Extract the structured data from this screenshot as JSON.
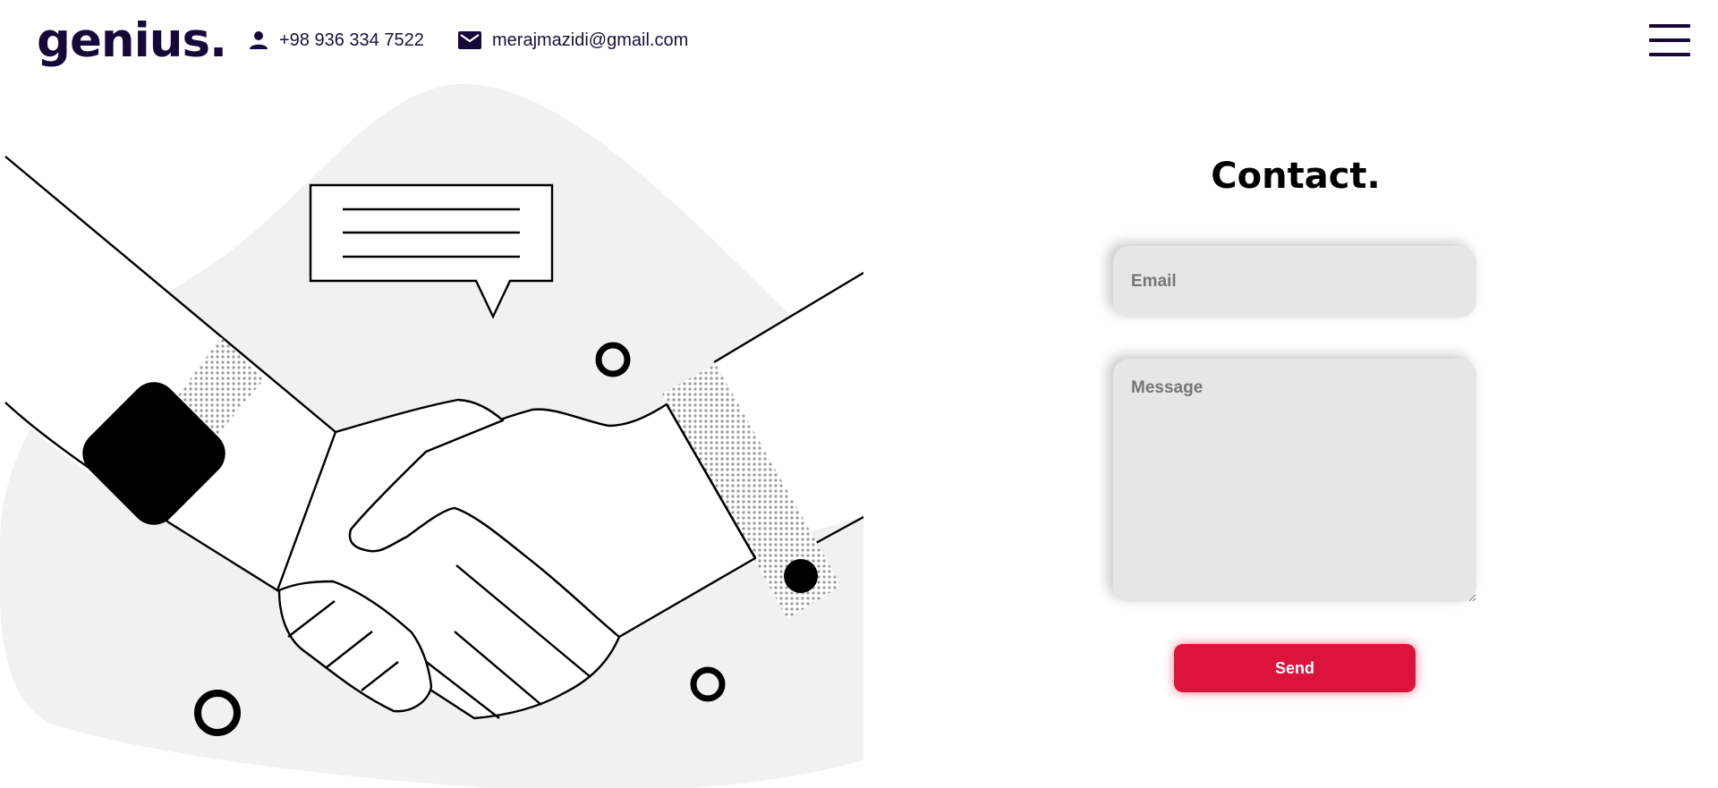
{
  "header": {
    "logo": "genius.",
    "phone": "+98 936 334 7522",
    "email": "merajmazidi@gmail.com"
  },
  "icons": {
    "phone_icon": "person-icon",
    "email_icon": "envelope-icon",
    "menu_icon": "hamburger-menu-icon"
  },
  "contact_form": {
    "title": "Contact.",
    "email_placeholder": "Email",
    "message_placeholder": "Message",
    "send_label": "Send"
  },
  "colors": {
    "brand_dark": "#16093a",
    "accent": "#dc143c",
    "blob": "#f1f1f1",
    "input_bg": "#e6e6e6"
  }
}
